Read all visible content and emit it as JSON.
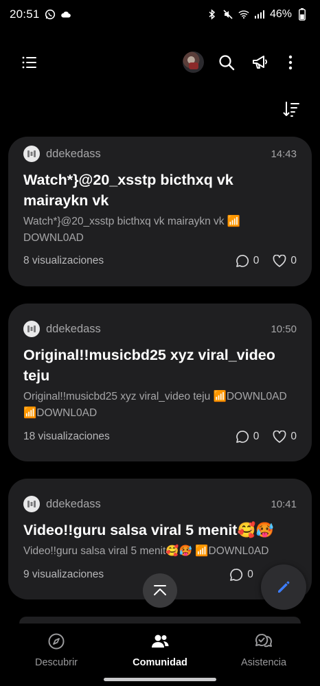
{
  "status_bar": {
    "time": "20:51",
    "battery": "46%",
    "left_icons": [
      "whatsapp-icon",
      "cloud-icon"
    ],
    "right_icons": [
      "bluetooth-icon",
      "mute-icon",
      "wifi-icon",
      "signal-icon"
    ]
  },
  "top_bar": {
    "icons": [
      "menu-icon",
      "avatar",
      "search-icon",
      "megaphone-icon",
      "more-vertical-icon"
    ]
  },
  "sort_icon": "sort-descending-icon",
  "posts": [
    {
      "author": "ddekedass",
      "time": "14:43",
      "title": "Watch*}@20_xsstp bicthxq vk mairaykn vk",
      "snippet": "Watch*}@20_xsstp bicthxq vk mairaykn vk 📶 DOWNL0AD",
      "views": "8 visualizaciones",
      "comments": "0",
      "likes": "0"
    },
    {
      "author": "ddekedass",
      "time": "10:50",
      "title": "Original!!musicbd25 xyz viral_video teju",
      "snippet": "Original!!musicbd25 xyz viral_video teju 📶DOWNL0AD 📶DOWNL0AD",
      "views": "18 visualizaciones",
      "comments": "0",
      "likes": "0"
    },
    {
      "author": "ddekedass",
      "time": "10:41",
      "title": "Video!!guru salsa viral 5 menit🥰🥵",
      "snippet": "Video!!guru salsa viral 5 menit🥰🥵 📶DOWNL0AD",
      "views": "9 visualizaciones",
      "comments": "0",
      "likes": ""
    }
  ],
  "bottom_nav": {
    "items": [
      {
        "label": "Descubrir",
        "icon": "compass-icon",
        "active": false
      },
      {
        "label": "Comunidad",
        "icon": "people-icon",
        "active": true
      },
      {
        "label": "Asistencia",
        "icon": "chat-support-icon",
        "active": false
      }
    ]
  },
  "colors": {
    "background": "#000000",
    "card": "#1f1f21",
    "compose_accent": "#3d7eff",
    "muted_text": "#a6a6a8"
  }
}
